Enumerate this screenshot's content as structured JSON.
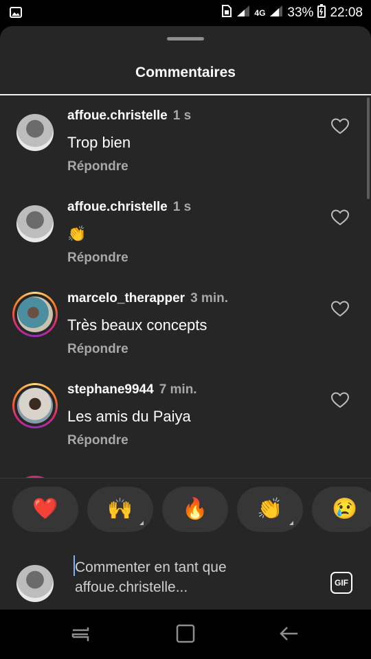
{
  "status_bar": {
    "battery_percent": "33%",
    "time": "22:08",
    "network": "4G",
    "icons": [
      "image-icon",
      "sim-icon",
      "signal-icon",
      "battery-icon"
    ]
  },
  "sheet": {
    "title": "Commentaires"
  },
  "comments": [
    {
      "username": "affoue.christelle",
      "time": "1 s",
      "text": "Trop bien",
      "reply": "Répondre",
      "story_ring": false
    },
    {
      "username": "affoue.christelle",
      "time": "1 s",
      "text": "👏",
      "reply": "Répondre",
      "story_ring": false
    },
    {
      "username": "marcelo_therapper",
      "time": "3 min.",
      "text": "Très beaux concepts",
      "reply": "Répondre",
      "story_ring": true
    },
    {
      "username": "stephane9944",
      "time": "7 min.",
      "text": "Les amis du Paiya",
      "reply": "Répondre",
      "story_ring": true
    }
  ],
  "reactions": [
    "❤️",
    "🙌",
    "🔥",
    "👏",
    "😢"
  ],
  "input": {
    "placeholder": "Commenter en tant que affoue.christelle...",
    "gif_label": "GIF"
  },
  "colors": {
    "sheet_bg": "#262626",
    "secondary_text": "#a8a8a8",
    "story_ring": "#d62976"
  },
  "nav_icons": [
    "recent-apps-icon",
    "home-icon",
    "back-icon"
  ]
}
